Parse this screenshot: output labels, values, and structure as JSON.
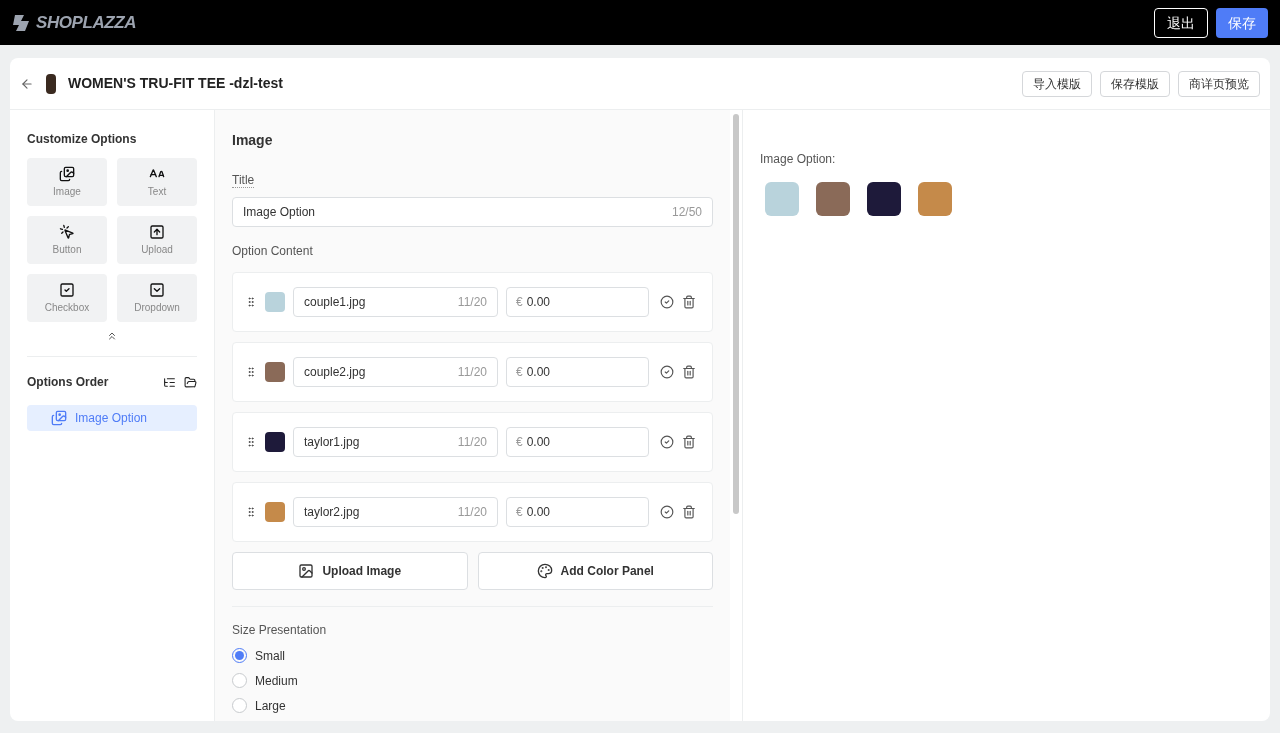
{
  "topbar": {
    "logo": "SHOPLAZZA",
    "buttons": [
      {
        "label": "退出",
        "kind": "outline"
      },
      {
        "label": "保存",
        "kind": "primary"
      }
    ]
  },
  "header": {
    "title": "WOMEN'S TRU-FIT TEE -dzl-test",
    "buttons": [
      "导入模版",
      "保存模版",
      "商详页预览"
    ]
  },
  "sidebar": {
    "title": "Customize Options",
    "components": [
      {
        "label": "Image",
        "kind": "image"
      },
      {
        "label": "Text",
        "kind": "text"
      },
      {
        "label": "Button",
        "kind": "button"
      },
      {
        "label": "Upload",
        "kind": "upload"
      },
      {
        "label": "Checkbox",
        "kind": "checkbox"
      },
      {
        "label": "Dropdown",
        "kind": "dropdown"
      }
    ],
    "order_title": "Options Order",
    "order_items": [
      {
        "label": "Image Option",
        "selected": true
      }
    ]
  },
  "editor": {
    "heading": "Image",
    "title_label": "Title",
    "title_value": "Image Option",
    "title_count": "12/50",
    "content_label": "Option Content",
    "options": [
      {
        "name": "couple1.jpg",
        "count": "11/20",
        "currency": "€",
        "price": "0.00"
      },
      {
        "name": "couple2.jpg",
        "count": "11/20",
        "currency": "€",
        "price": "0.00"
      },
      {
        "name": "taylor1.jpg",
        "count": "11/20",
        "currency": "€",
        "price": "0.00"
      },
      {
        "name": "taylor2.jpg",
        "count": "11/20",
        "currency": "€",
        "price": "0.00"
      }
    ],
    "actions": [
      {
        "label": "Upload Image",
        "kind": "image"
      },
      {
        "label": "Add Color Panel",
        "kind": "palette"
      }
    ],
    "size_label": "Size Presentation",
    "sizes": [
      {
        "label": "Small",
        "selected": true
      },
      {
        "label": "Medium",
        "selected": false
      },
      {
        "label": "Large",
        "selected": false
      }
    ]
  },
  "preview": {
    "label": "Image Option:"
  }
}
